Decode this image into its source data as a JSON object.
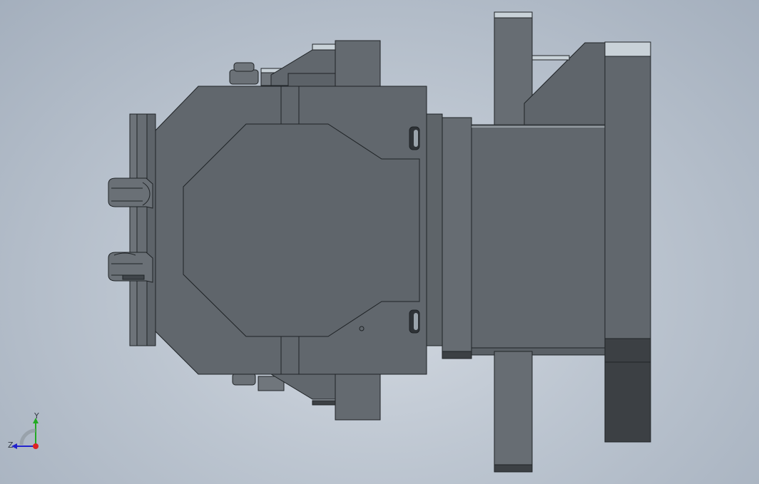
{
  "scene": {
    "part_fill": "#60666c",
    "part_fill_light": "#6b7177",
    "edge": "#1f2326",
    "highlight": "#c9d2d8",
    "dark_block": "#3c4044"
  },
  "triad": {
    "y_label": "Y",
    "z_label": "Z",
    "x_color": "#d22",
    "y_color": "#2a2",
    "z_color": "#22c"
  }
}
